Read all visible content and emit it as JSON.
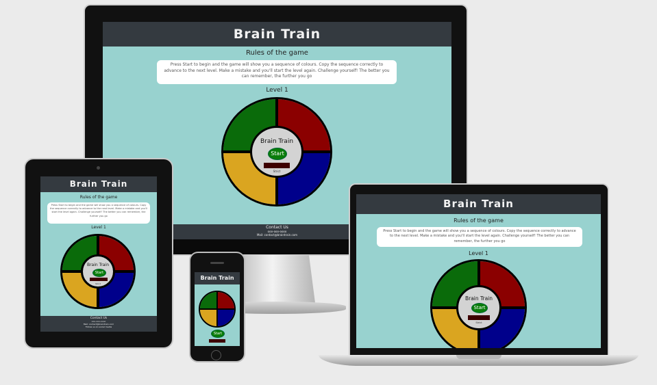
{
  "site": {
    "title": "Brain Train",
    "rules_title": "Rules of the game",
    "rules_text": "Press Start to begin and the game will show you a sequence of colours. Copy the sequence correctly to advance to the next level. Make a mistake and you'll start the level again. Challenge yourself! The better you can remember, the further you go",
    "level_label": "Level 1",
    "game_title": "Brain Train",
    "start_label": "Start",
    "strict_label": "Strict",
    "footer_title": "Contact Us",
    "footer_line1": "ooo-ooo-oooo",
    "footer_line2": "Mail: contact@braintrain.com",
    "footer_line3": "Follow us on social media"
  },
  "colors": {
    "header_bg": "#343a40",
    "page_bg": "#98d2cf",
    "green": "#0a6b0a",
    "red": "#8b0000",
    "yellow": "#daa520",
    "blue": "#00008b",
    "hub": "#d3d3d3"
  }
}
